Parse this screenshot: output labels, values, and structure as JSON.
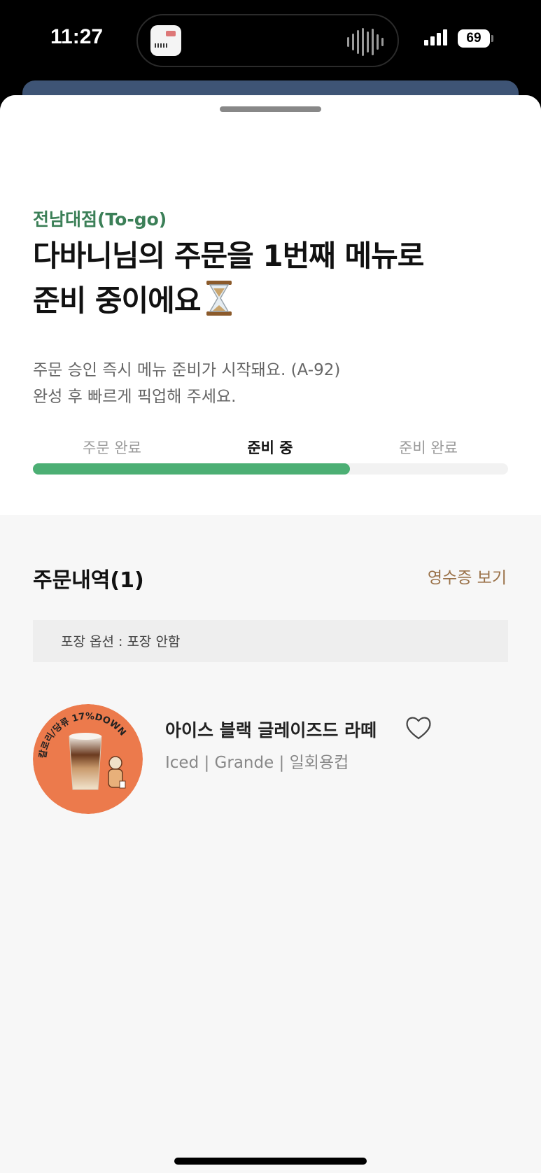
{
  "status_bar": {
    "time": "11:27",
    "battery": "69",
    "island_app_icon": "app-thumbnail-icon"
  },
  "header": {
    "store_name": "전남대점(To-go)",
    "headline_line1": "다바니님의 주문을 1번째 메뉴로",
    "headline_line2": "준비 중이에요",
    "headline_icon": "hourglass-icon",
    "subtitle_line1": "주문 승인 즉시 메뉴 준비가 시작돼요. (A-92)",
    "subtitle_line2": "완성 후 빠르게 픽업해 주세요."
  },
  "progress": {
    "steps": [
      {
        "label": "주문 완료",
        "active": false
      },
      {
        "label": "준비 중",
        "active": true
      },
      {
        "label": "준비 완료",
        "active": false
      }
    ],
    "fraction": 0.667,
    "color": "#4caf74"
  },
  "order": {
    "title": "주문내역(1)",
    "receipt_link": "영수증 보기",
    "packaging_option": "포장 옵션 : 포장 안함",
    "items": [
      {
        "name": "아이스 블랙 글레이즈드 라떼",
        "options": "Iced | Grande | 일회용컵",
        "badge": "칼로리/당류 17%DOWN",
        "favorite_icon": "heart-outline-icon"
      }
    ]
  },
  "colors": {
    "accent_green": "#3b7f57",
    "progress_green": "#4caf74",
    "receipt_brown": "#9a7148",
    "badge_orange": "#ec7a4c"
  }
}
